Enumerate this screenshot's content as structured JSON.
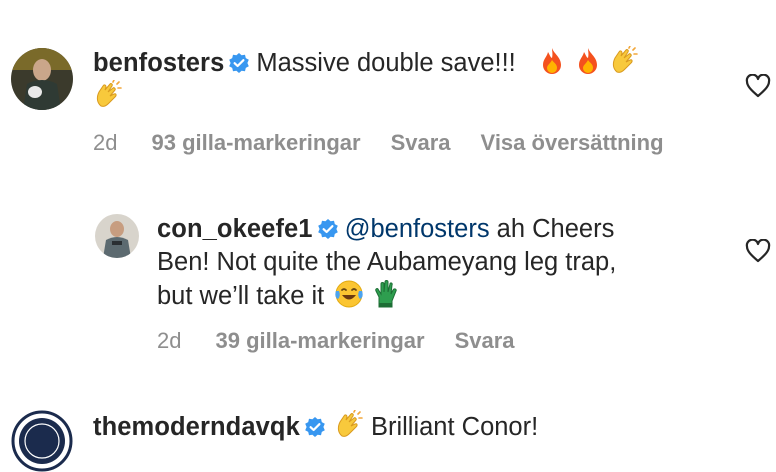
{
  "comments": [
    {
      "username": "benfosters",
      "verified": true,
      "text": "Massive double save!!!",
      "emojis": [
        "fire-emoji",
        "fire-emoji",
        "clapping-hands-emoji",
        "clapping-hands-emoji"
      ],
      "time": "2d",
      "likes": "93 gilla-markeringar",
      "reply": "Svara",
      "translate": "Visa översättning"
    },
    {
      "username": "con_okeefe1",
      "verified": true,
      "mention": "@benfosters",
      "text_line1": "ah Cheers",
      "text_line2": "Ben! Not quite the Aubameyang leg trap,",
      "text_line3": "but we’ll take it",
      "emojis": [
        "tears-of-joy-emoji",
        "goalkeeper-glove-emoji"
      ],
      "time": "2d",
      "likes": "39 gilla-markeringar",
      "reply": "Svara"
    },
    {
      "username": "themoderndavqk",
      "verified": true,
      "text": "Brilliant Conor!",
      "emojis": [
        "clapping-hands-emoji"
      ]
    }
  ],
  "icons": {
    "verified_color": "#3897f0",
    "heart": "heart-outline-icon"
  }
}
